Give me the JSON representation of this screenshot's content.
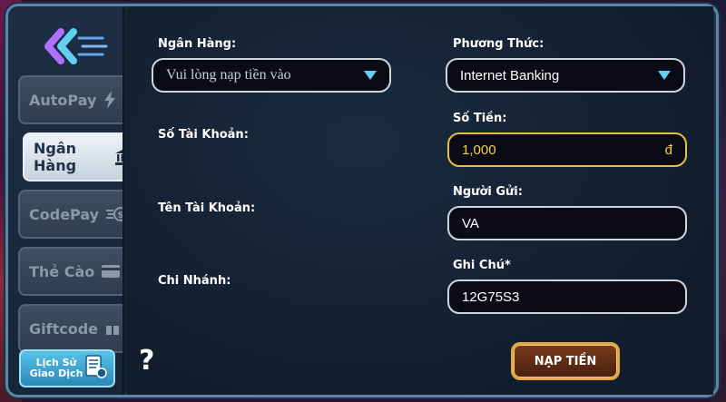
{
  "sidebar": {
    "tabs": [
      {
        "label": "AutoPay",
        "icon": "lightning-icon",
        "active": false
      },
      {
        "label": "Ngân Hàng",
        "icon": "bank-icon",
        "active": true
      },
      {
        "label": "CodePay",
        "icon": "coin-icon",
        "active": false
      },
      {
        "label": "Thẻ Cào",
        "icon": "card-icon",
        "active": false
      },
      {
        "label": "Giftcode",
        "icon": "gift-icon",
        "active": false
      }
    ],
    "history_label_line1": "Lịch Sử",
    "history_label_line2": "Giao Dịch"
  },
  "form": {
    "bank_label": "Ngân Hàng:",
    "bank_placeholder": "Vui lòng nạp tiền vào",
    "account_number_label": "Số Tài Khoản:",
    "account_name_label": "Tên Tài Khoản:",
    "branch_label": "Chi Nhánh:",
    "method_label": "Phương Thức:",
    "method_value": "Internet Banking",
    "amount_label": "Số Tiền:",
    "amount_value": "1,000",
    "currency_symbol": "đ",
    "sender_label": "Người Gửi:",
    "sender_value": "VA",
    "note_label": "Ghi Chú*",
    "note_value": "12G75S3"
  },
  "help_symbol": "?",
  "submit_label": "NẠP TIỀN",
  "colors": {
    "accent": "#5fd0f2",
    "amount": "#f2d150",
    "submit_border": "#e2a748"
  }
}
